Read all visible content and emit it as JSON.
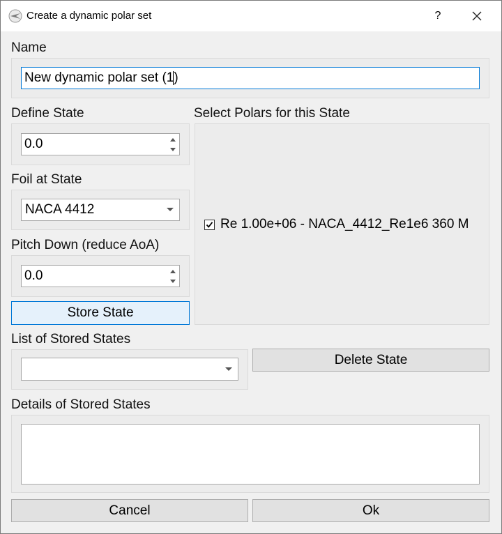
{
  "window": {
    "title": "Create a dynamic polar set",
    "help_glyph": "?",
    "icon": "qblade-app-icon"
  },
  "name_section": {
    "label": "Name",
    "value_before_caret": "New dynamic polar set (1",
    "value_after_caret": ")"
  },
  "define_state": {
    "label": "Define State",
    "value": "0.0"
  },
  "foil_at_state": {
    "label": "Foil at State",
    "selected": "NACA 4412"
  },
  "pitch_down": {
    "label": "Pitch Down (reduce AoA)",
    "value": "0.0"
  },
  "store_state_button": "Store State",
  "select_polars": {
    "label": "Select Polars for this State",
    "items": [
      {
        "label": "Re 1.00e+06 - NACA_4412_Re1e6 360 M",
        "checked": true
      }
    ]
  },
  "stored_states": {
    "label": "List of Stored States",
    "selected": "",
    "delete_button": "Delete State"
  },
  "details": {
    "label": "Details of Stored States",
    "content": ""
  },
  "footer": {
    "cancel": "Cancel",
    "ok": "Ok"
  },
  "colors": {
    "focus_border": "#0078d7",
    "default_button_bg": "#e5f1fb",
    "dialog_bg": "#f0f0f0"
  }
}
